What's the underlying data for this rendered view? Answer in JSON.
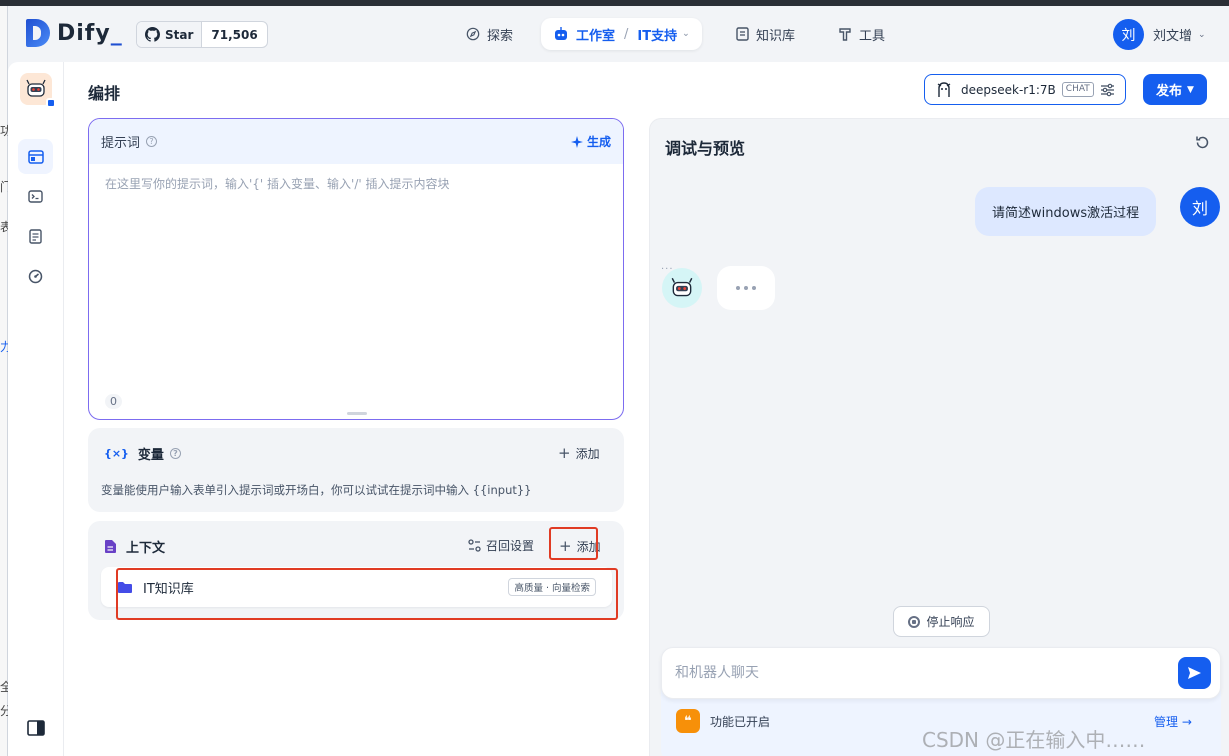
{
  "header": {
    "logo_text": "Dify",
    "github": {
      "star_label": "Star",
      "count": "71,506"
    },
    "nav": {
      "explore": "探索",
      "studio": "工作室",
      "studio_sub": "IT支持",
      "knowledge": "知识库",
      "tools": "工具"
    },
    "user": {
      "avatar": "刘",
      "name": "刘文增"
    }
  },
  "page": {
    "title": "编排",
    "model": {
      "name": "deepseek-r1:7B",
      "tag": "CHAT"
    },
    "publish": "发布"
  },
  "prompt": {
    "label": "提示词",
    "generate": "生成",
    "placeholder": "在这里写你的提示词，输入'{' 插入变量、输入'/' 插入提示内容块",
    "count": "0"
  },
  "variables": {
    "label": "变量",
    "add": "添加",
    "description": "变量能使用户输入表单引入提示词或开场白，你可以试试在提示词中输入 {{input}}"
  },
  "context": {
    "label": "上下文",
    "recall": "召回设置",
    "add": "添加",
    "kb_name": "IT知识库",
    "kb_tag": "高质量 · 向量检索"
  },
  "debug": {
    "title": "调试与预览",
    "user_message": "请简述windows激活过程",
    "user_avatar": "刘",
    "stop": "停止响应",
    "input_placeholder": "和机器人聊天",
    "features": "功能已开启",
    "manage": "管理"
  },
  "left_fragments": [
    "功",
    "门",
    "表",
    "力",
    "全",
    "分"
  ],
  "watermark": "CSDN @正在输入中……",
  "colors": {
    "accent": "#155eef",
    "highlight": "#e03b24",
    "prompt_border": "#7c6cf0"
  }
}
